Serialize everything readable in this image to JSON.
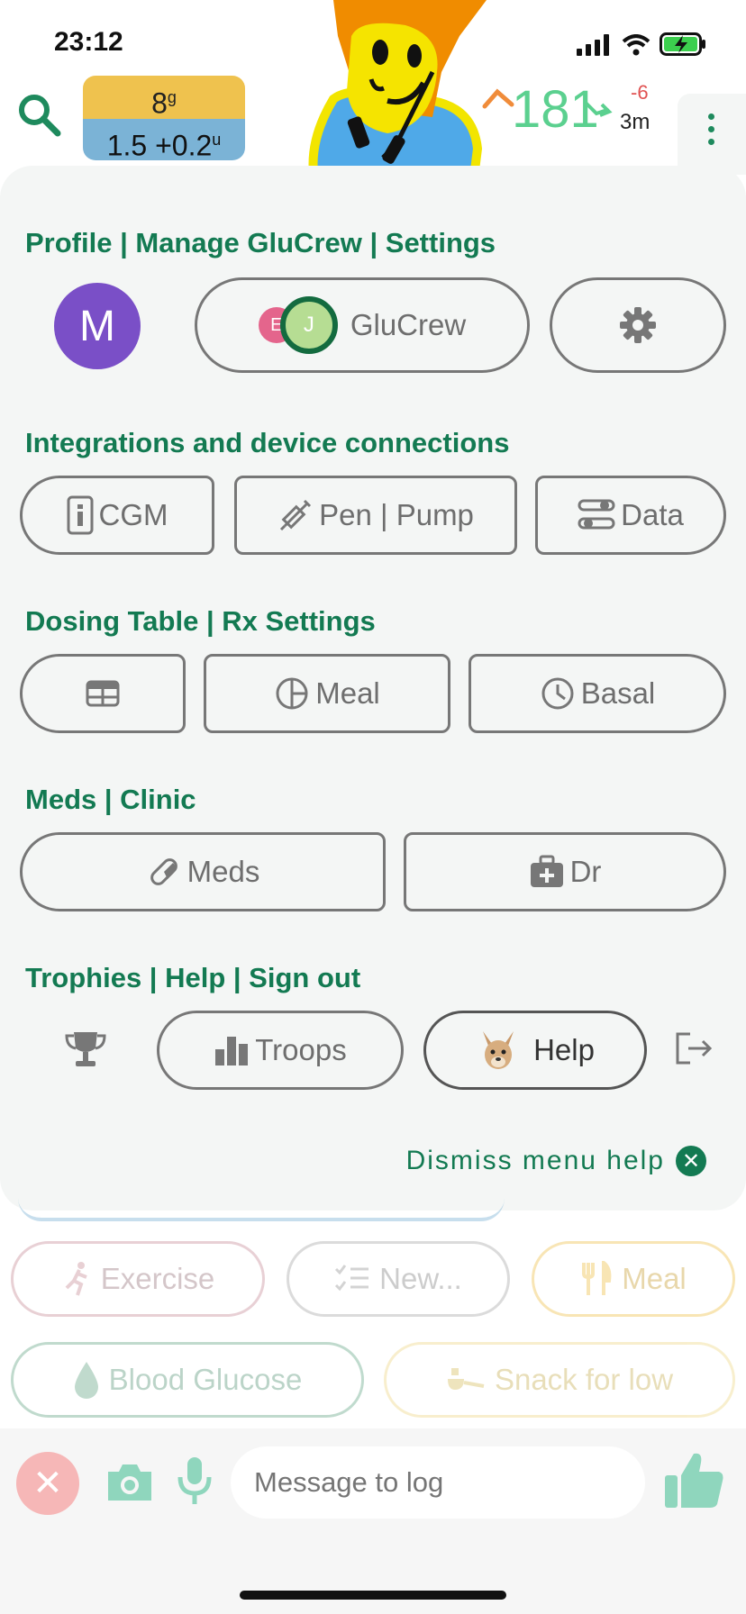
{
  "status_bar": {
    "time": "23:12"
  },
  "header": {
    "carbs_value": "8",
    "carbs_unit": "g",
    "insulin_value": "1.5 +0.2",
    "insulin_unit": "u",
    "glucose": "181",
    "delta": "-6",
    "age": "3m",
    "glucose_color": "#5bd08f",
    "delta_color": "#e05252"
  },
  "menu": {
    "profile": {
      "title": "Profile | Manage GluCrew | Settings",
      "avatar_letter": "M",
      "crew_e": "E",
      "crew_j": "J",
      "glucrew_label": "GluCrew"
    },
    "integrations": {
      "title": "Integrations and device connections",
      "cgm": "CGM",
      "pen_pump": "Pen | Pump",
      "data": "Data"
    },
    "dosing": {
      "title": "Dosing Table | Rx Settings",
      "meal": "Meal",
      "basal": "Basal"
    },
    "meds": {
      "title": "Meds | Clinic",
      "meds": "Meds",
      "dr": "Dr"
    },
    "trophies": {
      "title": "Trophies | Help | Sign out",
      "troops": "Troops",
      "help": "Help"
    },
    "dismiss": "Dismiss menu help"
  },
  "quick_actions": {
    "exercise": "Exercise",
    "new": "New...",
    "meal": "Meal",
    "blood_glucose": "Blood Glucose",
    "snack": "Snack for low"
  },
  "composer": {
    "placeholder": "Message to log"
  },
  "colors": {
    "accent": "#137a52",
    "pill_border": "#777777",
    "panel_bg": "#f4f6f5"
  }
}
